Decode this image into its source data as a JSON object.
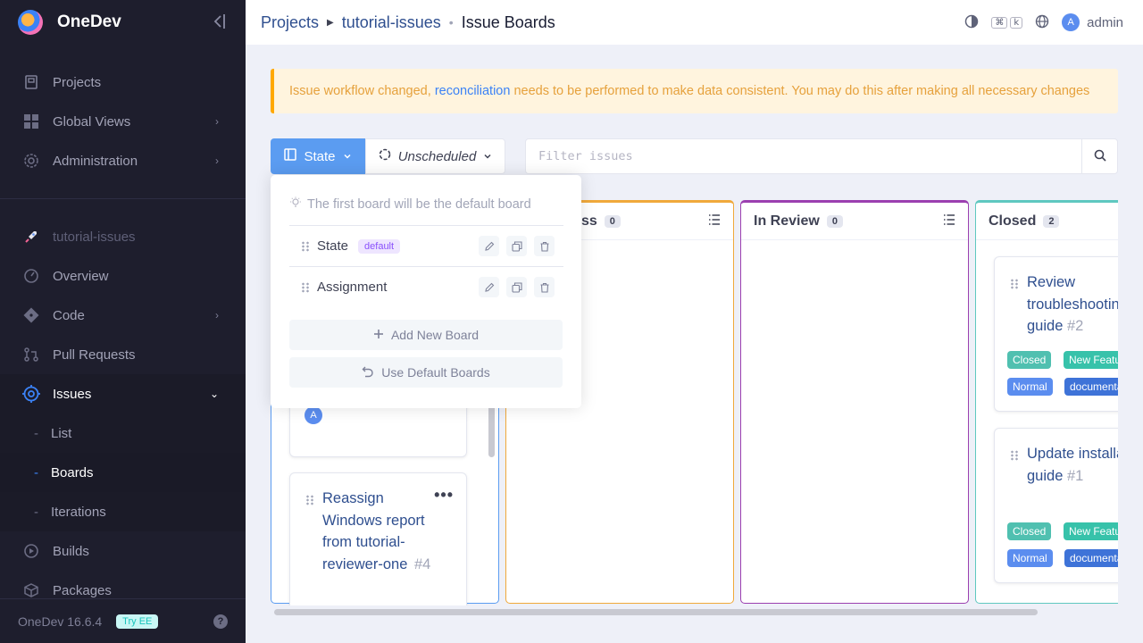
{
  "app": {
    "name": "OneDev",
    "version": "OneDev 16.6.4",
    "try_ee": "Try EE",
    "help": "?"
  },
  "sidebar": {
    "global": [
      {
        "label": "Projects"
      },
      {
        "label": "Global Views"
      },
      {
        "label": "Administration"
      }
    ],
    "project_name": "tutorial-issues",
    "project": [
      {
        "label": "Overview"
      },
      {
        "label": "Code"
      },
      {
        "label": "Pull Requests"
      },
      {
        "label": "Issues"
      },
      {
        "label": "List"
      },
      {
        "label": "Boards"
      },
      {
        "label": "Iterations"
      },
      {
        "label": "Builds"
      },
      {
        "label": "Packages"
      }
    ]
  },
  "breadcrumb": {
    "projects": "Projects",
    "project": "tutorial-issues",
    "current": "Issue Boards"
  },
  "topbar": {
    "shortcut_cmd": "⌘",
    "shortcut_key": "k",
    "avatar_letter": "A",
    "user": "admin"
  },
  "alert": {
    "before": "Issue workflow changed, ",
    "link": "reconciliation",
    "after": " needs to be performed to make data consistent. You may do this after making all necessary changes"
  },
  "toolbar": {
    "board_select": "State",
    "iteration_select": "Unscheduled",
    "filter_placeholder": "Filter issues"
  },
  "dropdown": {
    "hint": "The first board will be the default board",
    "boards": [
      {
        "label": "State",
        "badge": "default"
      },
      {
        "label": "Assignment",
        "badge": ""
      }
    ],
    "add_label": "Add New Board",
    "default_label": "Use Default Boards"
  },
  "columns": [
    {
      "title": "In Progress",
      "visible_title": "ss",
      "count": "0",
      "color": "#f0a93b"
    },
    {
      "title": "In Review",
      "count": "0",
      "color": "#9b3fb0"
    },
    {
      "title": "Closed",
      "count": "2",
      "color": "#5fc8c0"
    }
  ],
  "open_card": {
    "title": "Reassign Windows report from tutorial-reviewer-one",
    "number": "#4",
    "avatar": "A"
  },
  "closed_cards": [
    {
      "title": "Review troubleshooting guide",
      "number": "#2",
      "tags": [
        "Closed",
        "New Feature",
        "Normal",
        "documentation"
      ]
    },
    {
      "title": "Update installation guide",
      "number": "#1",
      "tags": [
        "Closed",
        "New Feature",
        "Normal",
        "documentation"
      ]
    }
  ],
  "colors": {
    "accent": "#5b9cf1",
    "sidebar_bg": "#1e1e2d",
    "alert_text": "#e6a13c"
  }
}
